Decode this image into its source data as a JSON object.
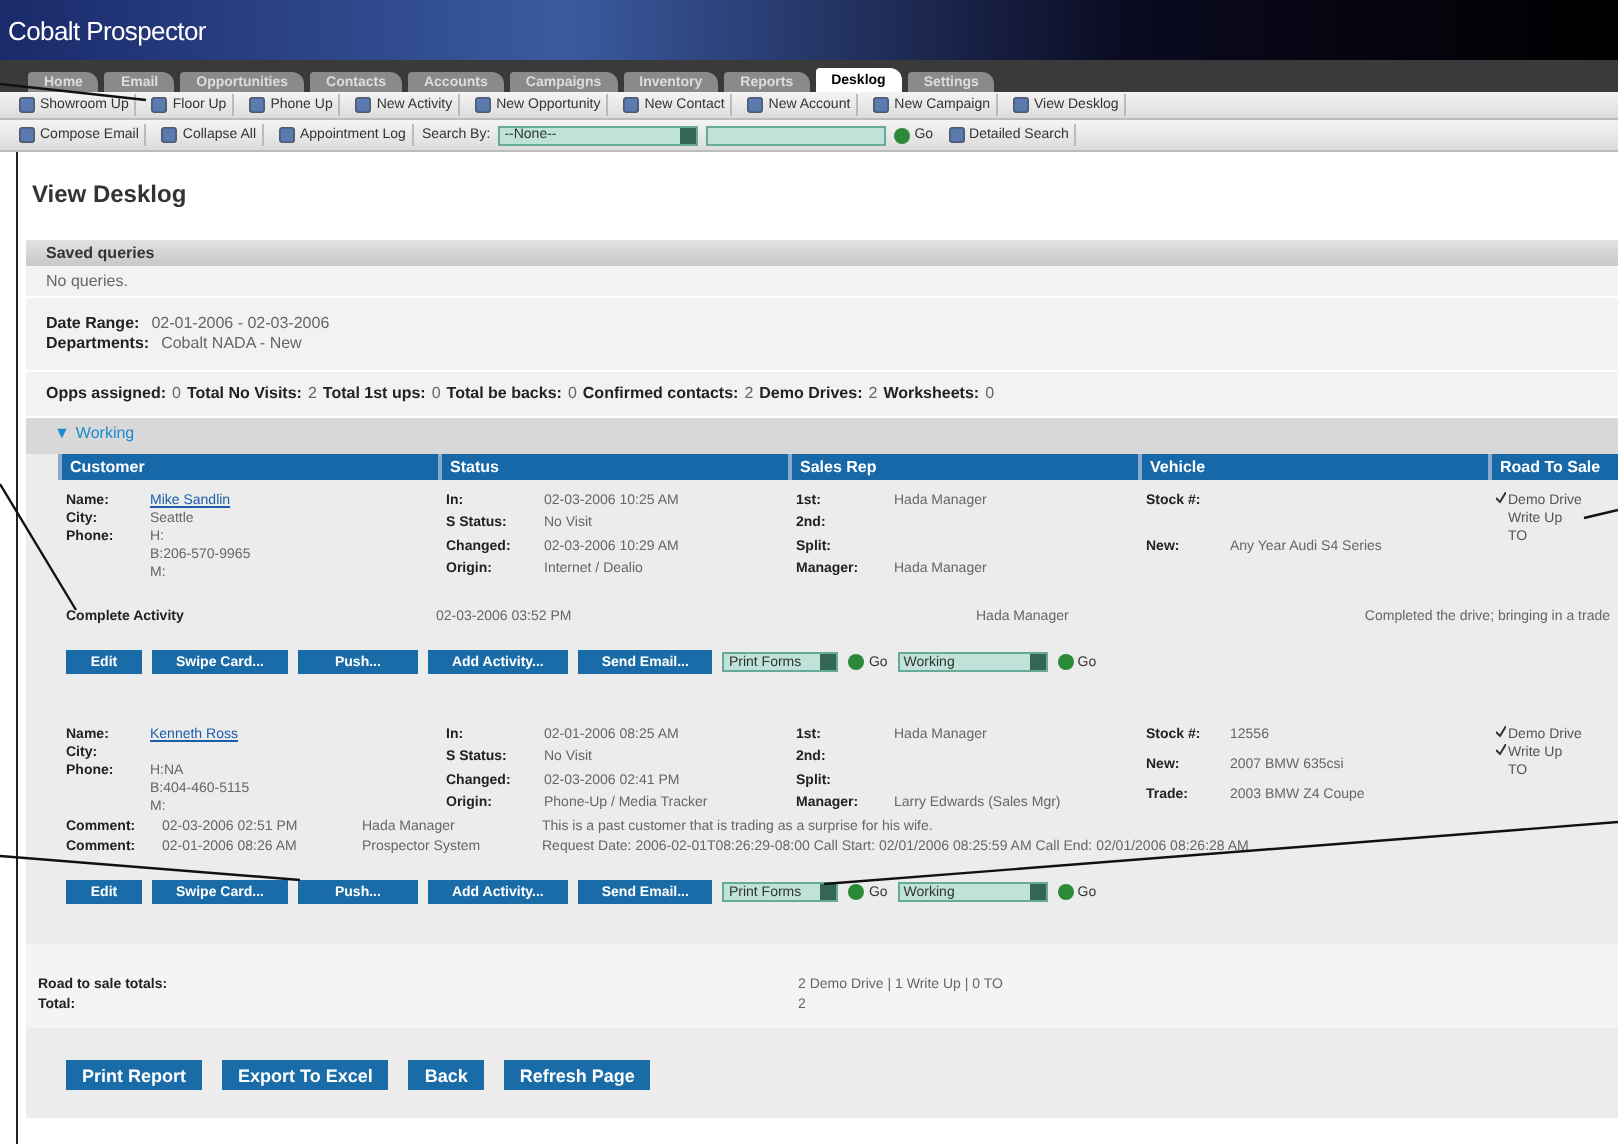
{
  "app": {
    "title": "Cobalt Prospector"
  },
  "tabs": [
    {
      "label": "Home",
      "selected": false
    },
    {
      "label": "Email",
      "selected": false
    },
    {
      "label": "Opportunities",
      "selected": false
    },
    {
      "label": "Contacts",
      "selected": false
    },
    {
      "label": "Accounts",
      "selected": false
    },
    {
      "label": "Campaigns",
      "selected": false
    },
    {
      "label": "Inventory",
      "selected": false
    },
    {
      "label": "Reports",
      "selected": false
    },
    {
      "label": "Desklog",
      "selected": true
    },
    {
      "label": "Settings",
      "selected": false
    }
  ],
  "toolbar": [
    "Showroom Up",
    "Floor Up",
    "Phone Up",
    "New Activity",
    "New Opportunity",
    "New Contact",
    "New Account",
    "New Campaign",
    "View Desklog"
  ],
  "search_bar": {
    "compose": "Compose Email",
    "collapse": "Collapse All",
    "appointments": "Appointment Log",
    "search_label": "Search By:",
    "search_by": "--None--",
    "go": "Go",
    "detailed": "Detailed Search"
  },
  "page_title": "View Desklog",
  "saved_queries": {
    "title": "Saved queries",
    "empty": "No queries."
  },
  "filters": [
    {
      "label": "Date Range:",
      "value": "02-01-2006 - 02-03-2006"
    },
    {
      "label": "Departments:",
      "value": "Cobalt NADA - New"
    }
  ],
  "stats": [
    {
      "label": "Opps assigned:",
      "value": "0"
    },
    {
      "label": "Total No Visits:",
      "value": "2"
    },
    {
      "label": "Total 1st ups:",
      "value": "0"
    },
    {
      "label": "Total be backs:",
      "value": "0"
    },
    {
      "label": "Confirmed contacts:",
      "value": "2"
    },
    {
      "label": "Demo Drives:",
      "value": "2"
    },
    {
      "label": "Worksheets:",
      "value": "0"
    }
  ],
  "group": {
    "marker": "▼",
    "title": "Working",
    "expanded": true
  },
  "columns": [
    "Customer",
    "Status",
    "Sales Rep",
    "Vehicle",
    "Road To Sale"
  ],
  "rows": [
    {
      "customer": [
        {
          "label": "Name:",
          "value": "Mike Sandlin",
          "link": true
        },
        {
          "label": "City:",
          "value": "Seattle"
        },
        {
          "label": "Phone:",
          "value": "H:"
        },
        {
          "value": "B:206-570-9965"
        },
        {
          "value": "M:"
        }
      ],
      "status": [
        {
          "label": "In:",
          "value": "02-03-2006 10:25 AM"
        },
        {
          "label": "S Status:",
          "value": "No Visit"
        },
        {
          "label": "Changed:",
          "value": "02-03-2006 10:29 AM"
        },
        {
          "label": "Origin:",
          "value": "Internet / Dealio"
        }
      ],
      "sales_rep": [
        {
          "label": "1st:",
          "value": "Hada Manager"
        },
        {
          "label": "2nd:"
        },
        {
          "label": "Split:"
        },
        {
          "label": "Manager:",
          "value": "Hada Manager"
        }
      ],
      "vehicle": [
        {
          "label": "Stock #:"
        },
        {
          "label": "New:",
          "value": "Any Year Audi S4 Series"
        }
      ],
      "road_to_sale": [
        {
          "label": "Demo Drive",
          "checked": true
        },
        {
          "label": "Write Up",
          "checked": false
        },
        {
          "label": "TO",
          "checked": false
        }
      ],
      "notes": [
        {
          "kind": "activity",
          "label": "Complete Activity",
          "date": "02-03-2006 03:52 PM",
          "by": "Hada Manager",
          "text": "Completed the drive; bringing in a trade"
        }
      ],
      "actions": [
        "Edit",
        "Swipe Card...",
        "Push...",
        "Add Activity...",
        "Send Email..."
      ],
      "forms": "Print Forms",
      "stage": "Working",
      "go": [
        "Go",
        "Go"
      ]
    },
    {
      "customer": [
        {
          "label": "Name:",
          "value": "Kenneth Ross",
          "link": true
        },
        {
          "label": "City:"
        },
        {
          "label": "Phone:",
          "value": "H:NA"
        },
        {
          "value": "B:404-460-5115"
        },
        {
          "value": "M:"
        }
      ],
      "status": [
        {
          "label": "In:",
          "value": "02-01-2006 08:25 AM"
        },
        {
          "label": "S Status:",
          "value": "No Visit"
        },
        {
          "label": "Changed:",
          "value": "02-03-2006 02:41 PM"
        },
        {
          "label": "Origin:",
          "value": "Phone-Up / Media Tracker"
        }
      ],
      "sales_rep": [
        {
          "label": "1st:",
          "value": "Hada Manager"
        },
        {
          "label": "2nd:"
        },
        {
          "label": "Split:"
        },
        {
          "label": "Manager:",
          "value": "Larry Edwards (Sales Mgr)"
        }
      ],
      "vehicle": [
        {
          "label": "Stock #:",
          "value": "12556"
        },
        {
          "label": "New:",
          "value": "2007 BMW 635csi"
        },
        {
          "label": "Trade:",
          "value": "2003 BMW Z4 Coupe"
        }
      ],
      "road_to_sale": [
        {
          "label": "Demo Drive",
          "checked": true
        },
        {
          "label": "Write Up",
          "checked": true
        },
        {
          "label": "TO",
          "checked": false
        }
      ],
      "notes": [
        {
          "kind": "comment",
          "label": "Comment:",
          "date": "02-03-2006 02:51 PM",
          "by": "Hada Manager",
          "text": "This is a past customer that is trading as a surprise for his wife."
        },
        {
          "kind": "comment",
          "label": "Comment:",
          "date": "02-01-2006 08:26 AM",
          "by": "Prospector System",
          "text": "Request Date: 2006-02-01T08:26:29-08:00 Call Start: 02/01/2006 08:25:59 AM Call End: 02/01/2006 08:26:28 AM"
        }
      ],
      "actions": [
        "Edit",
        "Swipe Card...",
        "Push...",
        "Add Activity...",
        "Send Email..."
      ],
      "forms": "Print Forms",
      "stage": "Working",
      "go": [
        "Go",
        "Go"
      ]
    }
  ],
  "totals": [
    {
      "label": "Road to sale totals:",
      "value": "2 Demo Drive | 1 Write Up | 0 TO"
    },
    {
      "label": "Total:",
      "value": "2"
    }
  ],
  "buttons": [
    "Print Report",
    "Export To Excel",
    "Back",
    "Refresh Page"
  ]
}
